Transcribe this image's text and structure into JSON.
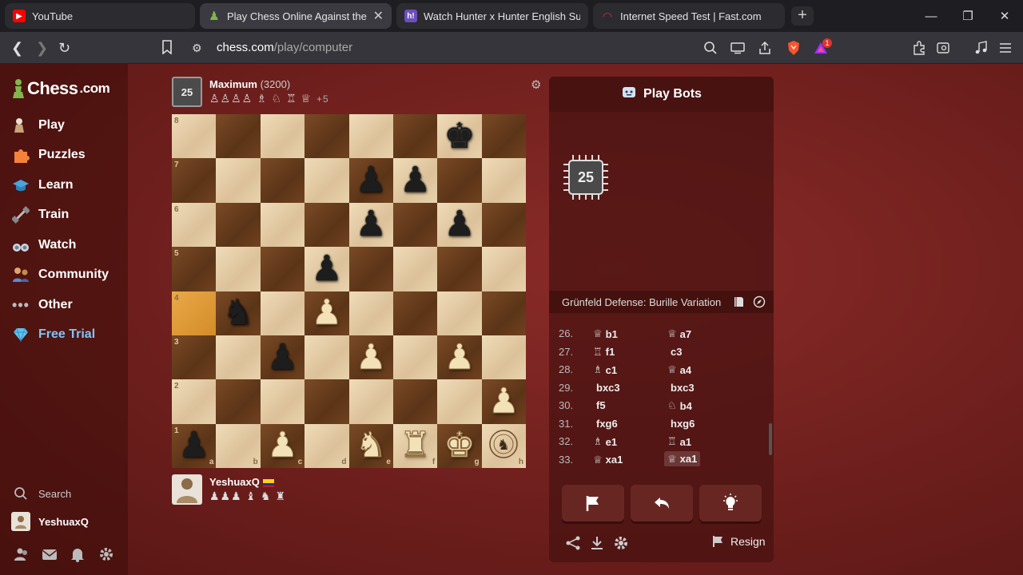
{
  "browser": {
    "tabs": [
      {
        "title": "YouTube",
        "fav_color": "#ff0000",
        "fav_glyph": "▶",
        "active": false
      },
      {
        "title": "Play Chess Online Against the Computer",
        "fav_color": "#81b64c",
        "fav_glyph": "♟",
        "active": true
      },
      {
        "title": "Watch Hunter x Hunter English Sub/Dub",
        "fav_color": "#6b4fbb",
        "fav_glyph": "h!",
        "active": false
      },
      {
        "title": "Internet Speed Test | Fast.com",
        "fav_color": "#e0322c",
        "fav_glyph": "◠",
        "active": false
      }
    ],
    "url_host": "chess.com",
    "url_path": "/play/computer",
    "notif_badge": "1"
  },
  "sidebar": {
    "logo_main": "Chess",
    "logo_suffix": ".com",
    "items": [
      {
        "label": "Play",
        "icon": "pawn-hand-icon"
      },
      {
        "label": "Puzzles",
        "icon": "puzzle-icon"
      },
      {
        "label": "Learn",
        "icon": "graduation-cap-icon"
      },
      {
        "label": "Train",
        "icon": "dumbbell-icon"
      },
      {
        "label": "Watch",
        "icon": "binoculars-icon"
      },
      {
        "label": "Community",
        "icon": "community-icon"
      },
      {
        "label": "Other",
        "icon": "more-dots-icon"
      },
      {
        "label": "Free Trial",
        "icon": "diamond-icon"
      }
    ],
    "search_label": "Search",
    "username": "YeshuaxQ"
  },
  "opponent": {
    "name": "Maximum",
    "rating": "(3200)",
    "level": "25",
    "captured": "♙♙♙♙ ♗ ♘ ♖ ♕",
    "advantage": "+5"
  },
  "player": {
    "name": "YeshuaxQ",
    "captured": "♟♟♟ ♝ ♞ ♜"
  },
  "board": {
    "ranks": [
      "8",
      "7",
      "6",
      "5",
      "4",
      "3",
      "2",
      "1"
    ],
    "files": [
      "a",
      "b",
      "c",
      "d",
      "e",
      "f",
      "g",
      "h"
    ],
    "position": [
      [
        "",
        "",
        "",
        "",
        "",
        "",
        "bK",
        ""
      ],
      [
        "",
        "",
        "",
        "",
        "bP",
        "bP",
        "",
        ""
      ],
      [
        "",
        "",
        "",
        "",
        "bP",
        "",
        "bP",
        ""
      ],
      [
        "",
        "",
        "",
        "bP",
        "",
        "",
        "",
        ""
      ],
      [
        "",
        "bN",
        "",
        "wP",
        "",
        "",
        "",
        ""
      ],
      [
        "",
        "",
        "bP",
        "",
        "wP",
        "",
        "wP",
        ""
      ],
      [
        "",
        "",
        "",
        "",
        "",
        "",
        "",
        "wP"
      ],
      [
        "bP",
        "",
        "wP",
        "",
        "wN",
        "wR",
        "wK",
        "logo"
      ]
    ],
    "highlight": "a4"
  },
  "panel": {
    "title": "Play Bots",
    "bot_level": "25",
    "opening": "Grünfeld Defense: Burille Variation",
    "moves": [
      {
        "num": "26.",
        "w_fig": "♕",
        "w": "b1",
        "b_fig": "♕",
        "b": "a7"
      },
      {
        "num": "27.",
        "w_fig": "♖",
        "w": "f1",
        "b_fig": "",
        "b": "c3"
      },
      {
        "num": "28.",
        "w_fig": "♗",
        "w": "c1",
        "b_fig": "♕",
        "b": "a4"
      },
      {
        "num": "29.",
        "w_fig": "",
        "w": "bxc3",
        "b_fig": "",
        "b": "bxc3"
      },
      {
        "num": "30.",
        "w_fig": "",
        "w": "f5",
        "b_fig": "♘",
        "b": "b4"
      },
      {
        "num": "31.",
        "w_fig": "",
        "w": "fxg6",
        "b_fig": "",
        "b": "hxg6"
      },
      {
        "num": "32.",
        "w_fig": "♗",
        "w": "e1",
        "b_fig": "♖",
        "b": "a1"
      },
      {
        "num": "33.",
        "w_fig": "♕",
        "w": "xa1",
        "b_fig": "♕",
        "b": "xa1"
      }
    ],
    "resign_label": "Resign"
  }
}
